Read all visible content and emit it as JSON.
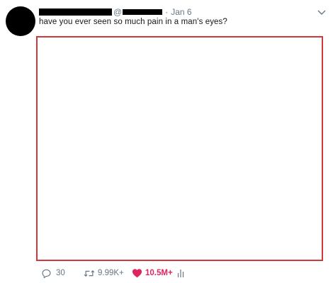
{
  "tweet": {
    "handle_text": "@",
    "separator": "·",
    "date": "Jan 6",
    "text": "have you ever seen so much pain in a man's eyes?",
    "media_border_color": "#d0393b"
  },
  "actions": {
    "reply_count": "30",
    "retweet_count": "9.99K+",
    "like_count": "10.5M+",
    "like_color": "#e0245e",
    "icons": [
      "reply-icon",
      "retweet-icon",
      "heart-icon",
      "analytics-icon"
    ]
  },
  "header_icons": [
    "chevron-down-icon"
  ]
}
